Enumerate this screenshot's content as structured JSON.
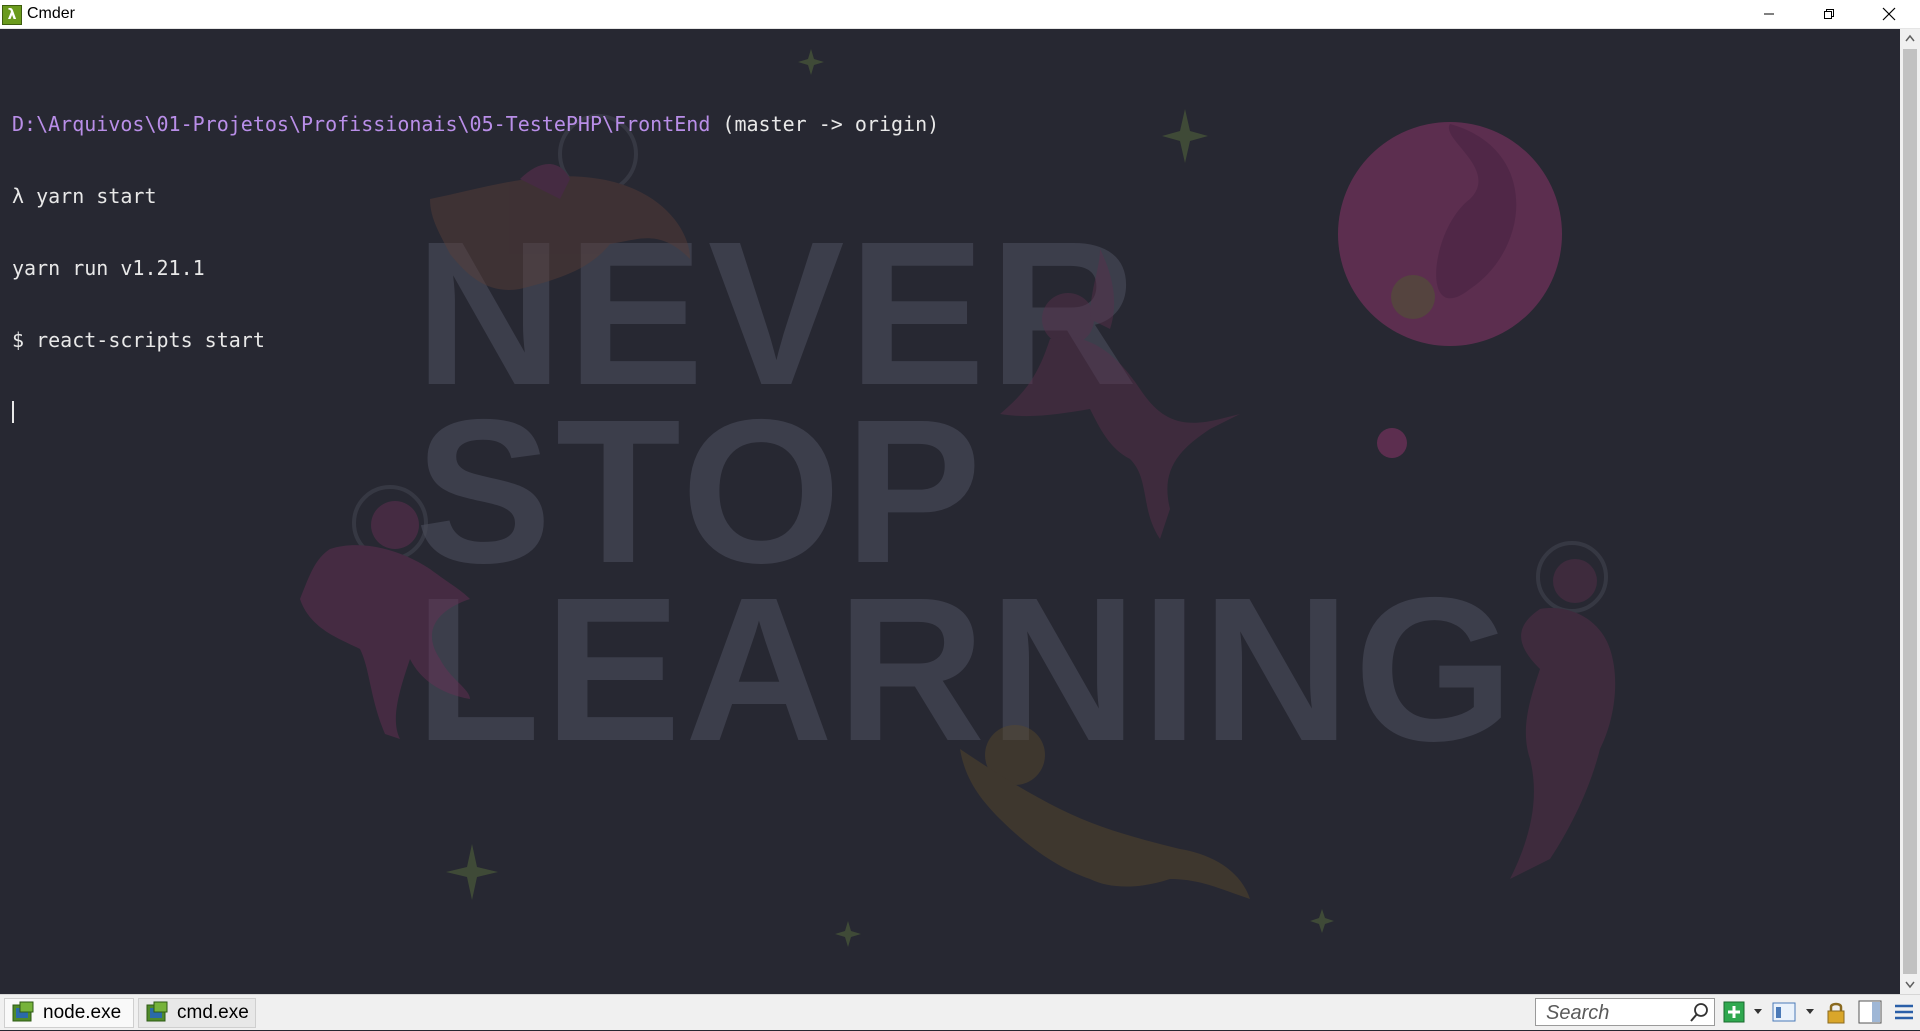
{
  "window": {
    "title": "Cmder",
    "app_icon_glyph": "λ",
    "controls": [
      "minimize-icon",
      "restore-icon",
      "close-icon"
    ]
  },
  "terminal": {
    "path": "D:\\Arquivos\\01-Projetos\\Profissionais\\05-TestePHP\\FrontEnd",
    "branch": " (master -> origin)",
    "lines": [
      "λ yarn start",
      "yarn run v1.21.1",
      "$ react-scripts start"
    ],
    "background_color": "#272832",
    "path_color": "#b98ee8"
  },
  "wallpaper": {
    "line1": "NEVER",
    "line2": "STOP",
    "line3": "LEARNING"
  },
  "tabs": [
    {
      "label": "node.exe"
    },
    {
      "label": "cmd.exe"
    }
  ],
  "search": {
    "placeholder": "Search"
  },
  "toolbar": {
    "icons": [
      "new-console-icon",
      "console-list-icon",
      "lock-icon",
      "split-view-icon",
      "menu-icon"
    ]
  }
}
